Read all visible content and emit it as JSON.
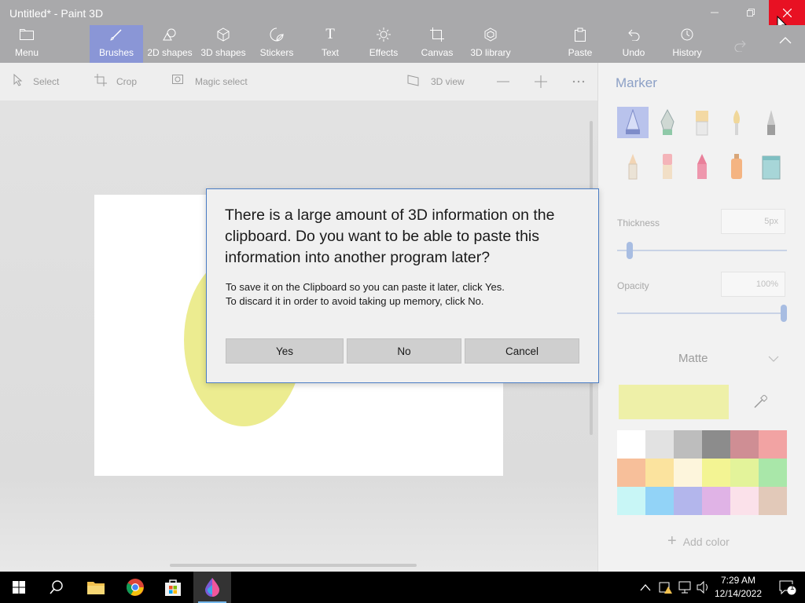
{
  "window": {
    "title": "Untitled* - Paint 3D",
    "minimize_icon": "minimize-icon",
    "restore_icon": "restore-icon",
    "close_icon": "close-icon"
  },
  "ribbon": {
    "menu": "Menu",
    "tabs": [
      {
        "label": "Brushes",
        "icon": "brush-icon",
        "active": true
      },
      {
        "label": "2D shapes",
        "icon": "2d-shapes-icon"
      },
      {
        "label": "3D shapes",
        "icon": "3d-shapes-icon"
      },
      {
        "label": "Stickers",
        "icon": "stickers-icon"
      },
      {
        "label": "Text",
        "icon": "text-icon"
      },
      {
        "label": "Effects",
        "icon": "effects-icon"
      },
      {
        "label": "Canvas",
        "icon": "canvas-icon"
      },
      {
        "label": "3D library",
        "icon": "3d-library-icon"
      }
    ],
    "actions": [
      {
        "label": "Paste",
        "icon": "paste-icon"
      },
      {
        "label": "Undo",
        "icon": "undo-icon"
      },
      {
        "label": "History",
        "icon": "history-icon"
      }
    ]
  },
  "toolbar": {
    "select": "Select",
    "crop": "Crop",
    "magic_select": "Magic select",
    "view_3d": "3D view"
  },
  "panel": {
    "title": "Marker",
    "thickness_label": "Thickness",
    "thickness_value": "5px",
    "thickness_level": 0.06,
    "opacity_label": "Opacity",
    "opacity_value": "100%",
    "opacity_level": 1.0,
    "finish": "Matte",
    "selected_color": "#eef0a8",
    "add_color": "Add color",
    "palette": [
      "#ffffff",
      "#e2e2e2",
      "#bdbdbd",
      "#8c8c8c",
      "#cf8e94",
      "#f2a3a3",
      "#f7bf9a",
      "#fbe39e",
      "#fdf5dc",
      "#f3f493",
      "#e3f39a",
      "#a9e7a9",
      "#c8f6f6",
      "#92d3f7",
      "#b3b6ec",
      "#e0b3e6",
      "#fbe1ea",
      "#e2c9b9"
    ]
  },
  "dialog": {
    "heading": "There is a large amount of 3D information on the clipboard. Do you want to be able to paste this information into another program later?",
    "line1": "To save it on the Clipboard so you can paste it later, click Yes.",
    "line2": "To discard it in order to avoid taking up memory, click No.",
    "yes": "Yes",
    "no": "No",
    "cancel": "Cancel"
  },
  "taskbar": {
    "time": "7:29 AM",
    "date": "12/14/2022",
    "notification_count": "1"
  }
}
